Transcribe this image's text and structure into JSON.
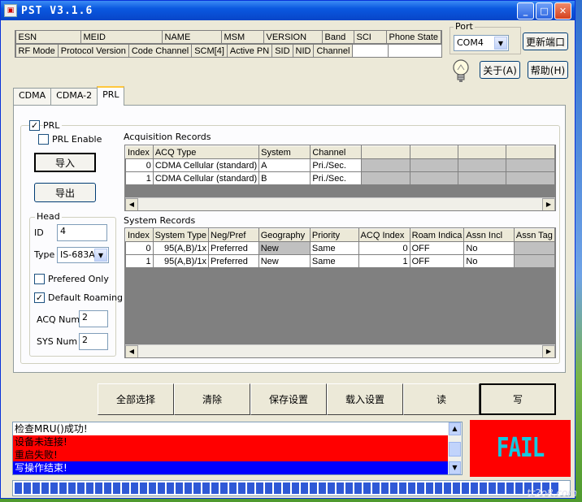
{
  "window": {
    "title": "PST V3.1.6",
    "min_label": "_",
    "max_label": "□",
    "close_label": "✕"
  },
  "info_grid": {
    "row1": [
      "ESN",
      "MEID",
      "NAME",
      "MSM",
      "VERSION",
      "Band",
      "SCI",
      "Phone State"
    ],
    "row3": [
      "RF Mode",
      "Protocol Version",
      "Code Channel",
      "SCM[4]",
      "Active PN",
      "SID",
      "NID",
      "Channel"
    ]
  },
  "port": {
    "legend": "Port",
    "value": "COM4",
    "refresh_label": "更新端口"
  },
  "about_label": "关于(A)",
  "help_label": "帮助(H)",
  "tabs": [
    "CDMA",
    "CDMA-2",
    "PRL"
  ],
  "prl": {
    "group_label": "PRL",
    "enable_label": "PRL Enable",
    "import_label": "导入",
    "export_label": "导出",
    "head": {
      "legend": "Head",
      "id_label": "ID",
      "id_value": "4",
      "type_label": "Type",
      "type_value": "IS-683A",
      "preferred_only_label": "Prefered Only",
      "default_roaming_label": "Default Roaming",
      "acq_num_label": "ACQ Num",
      "acq_num_value": "2",
      "sys_num_label": "SYS Num",
      "sys_num_value": "2"
    },
    "acq": {
      "title": "Acquisition Records",
      "columns": [
        "Index",
        "ACQ Type",
        "System",
        "Channel"
      ],
      "rows": [
        [
          "0",
          "CDMA Cellular (standard)",
          "A",
          "Pri./Sec."
        ],
        [
          "1",
          "CDMA Cellular (standard)",
          "B",
          "Pri./Sec."
        ]
      ]
    },
    "sys": {
      "title": "System Records",
      "columns": [
        "Index",
        "System Type",
        "Neg/Pref",
        "Geography",
        "Priority",
        "ACQ Index",
        "Roam Indica",
        "Assn Incl",
        "Assn Tag"
      ],
      "rows": [
        [
          "0",
          "95(A,B)/1x",
          "Preferred",
          "New",
          "Same",
          "0",
          "OFF",
          "No"
        ],
        [
          "1",
          "95(A,B)/1x",
          "Preferred",
          "New",
          "Same",
          "1",
          "OFF",
          "No"
        ]
      ]
    }
  },
  "actions": [
    "全部选择",
    "清除",
    "保存设置",
    "载入设置",
    "读",
    "写"
  ],
  "log": [
    {
      "text": "检查MRU()成功!",
      "bg": "#ffffff",
      "fg": "#000000"
    },
    {
      "text": "设备未连接!",
      "bg": "#ff0000",
      "fg": "#000000"
    },
    {
      "text": "重启失败!",
      "bg": "#ff0000",
      "fg": "#000000"
    },
    {
      "text": "写操作结束!",
      "bg": "#0000ff",
      "fg": "#ffffff"
    }
  ],
  "result": {
    "text": "FAIL",
    "bg": "#ff0000",
    "fg": "#15c8e0"
  },
  "progress": 1.0,
  "watermark": "tr2o8.com"
}
